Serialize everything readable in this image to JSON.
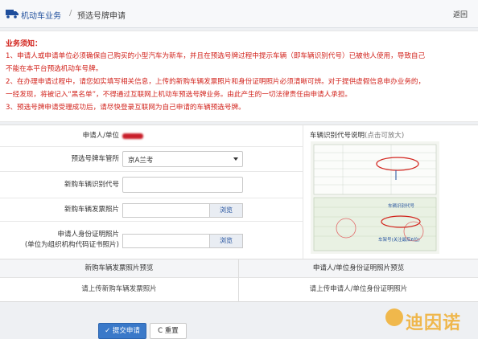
{
  "header": {
    "breadcrumb_1": "机动车业务",
    "separator": "/",
    "breadcrumb_2": "预选号牌申请",
    "back_label": "返回"
  },
  "notice": {
    "title": "业务须知：",
    "lines": [
      "1、申请人或申请单位必须确保自己购买的小型汽车为新车，并且在预选号牌过程中提示车辆（即车辆识别代号）已被他人使用，导致自己",
      "不能在本平台预选机动车号牌。",
      "2、在办理申请过程中，请您如实填写相关信息，上传的新购车辆发票照片和身份证明照片必须清晰可辨。对于提供虚假信息申办业务的，",
      "一经发现，将被记入“黑名单”，不得通过互联网上机动车预选号牌业务。由此产生的一切法律责任由申请人承担。",
      "3、预选号牌申请受理成功后，请尽快登录互联网为自己申请的车辆预选号牌。"
    ]
  },
  "form": {
    "applicant_label": "申请人/单位",
    "office_label": "预选号牌车管所",
    "office_value": "京A兰考",
    "vin_label": "新购车辆识别代号",
    "vin_value": "",
    "invoice_label": "新购车辆发票照片",
    "invoice_browse": "浏览",
    "id_label_1": "申请人身份证明照片",
    "id_label_2": "(单位为组织机构代码证书照片)",
    "id_browse": "浏览"
  },
  "vin_help": {
    "title": "车辆识别代号说明",
    "hint": "(点击可放大)",
    "annotation_1": "车辆识别代号",
    "annotation_2": "车架号(关注最后6位)"
  },
  "preview": {
    "invoice_head": "新购车辆发票照片预览",
    "invoice_body": "请上传新购车辆发票照片",
    "id_head": "申请人/单位身份证明照片预览",
    "id_body": "请上传申请人/单位身份证明照片"
  },
  "actions": {
    "submit_label": "提交申请",
    "reset_label": "C 重置"
  },
  "watermark": {
    "text": "迪因诺"
  },
  "colors": {
    "primary": "#3a79c9",
    "notice_red": "#d2231c",
    "link_blue": "#1f4e9c",
    "watermark": "#f0b13a"
  }
}
